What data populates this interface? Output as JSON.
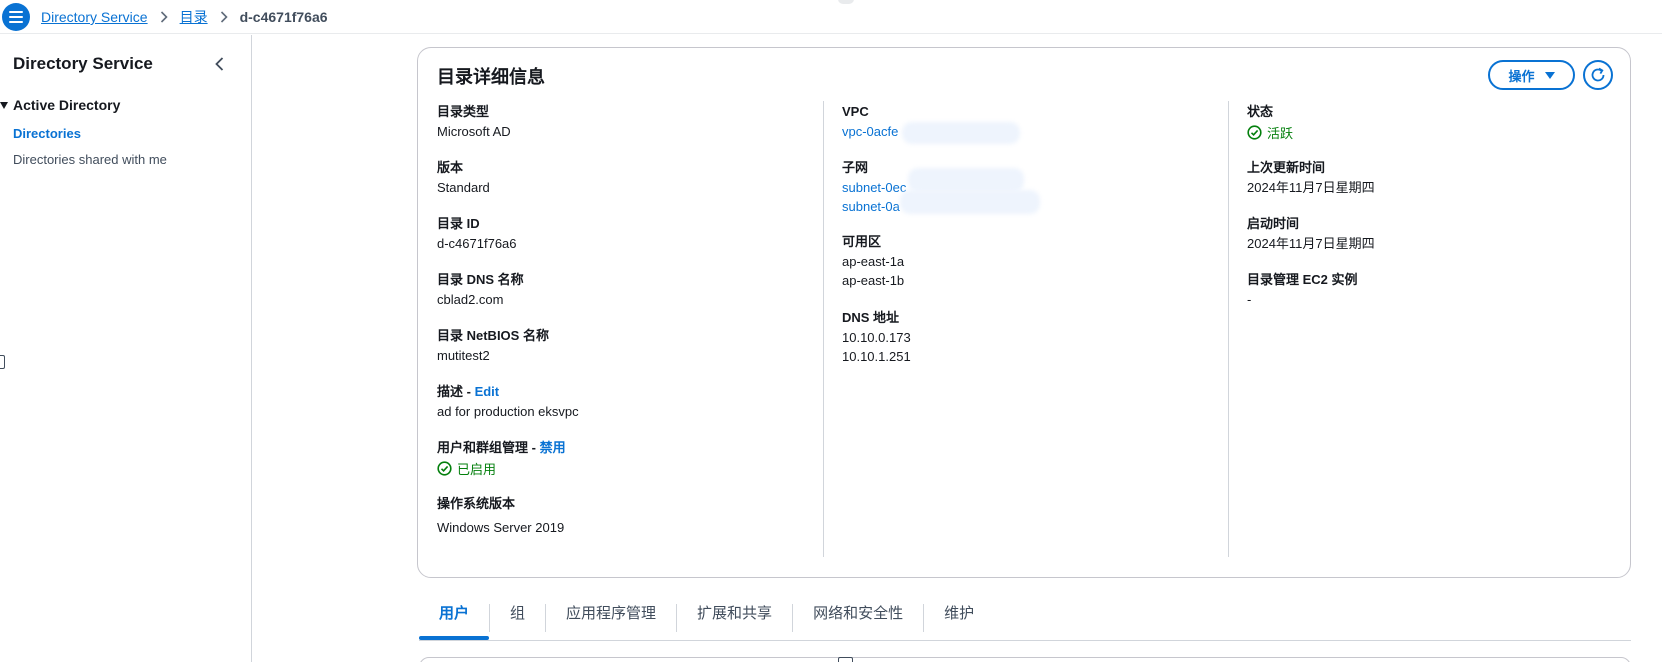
{
  "breadcrumb": {
    "items": [
      "Directory Service",
      "目录"
    ],
    "current": "d-c4671f76a6"
  },
  "sidebar": {
    "title": "Directory Service",
    "section": "Active Directory",
    "items": [
      {
        "label": "Directories",
        "active": true
      },
      {
        "label": "Directories shared with me",
        "active": false
      }
    ]
  },
  "card": {
    "title": "目录详细信息",
    "actions_label": "操作",
    "col1": {
      "type_label": "目录类型",
      "type_value": "Microsoft AD",
      "edition_label": "版本",
      "edition_value": "Standard",
      "id_label": "目录 ID",
      "id_value": "d-c4671f76a6",
      "dns_name_label": "目录 DNS 名称",
      "dns_name_value": "cblad2.com",
      "netbios_label": "目录 NetBIOS 名称",
      "netbios_value": "mutitest2",
      "desc_label": "描述 - ",
      "desc_edit": "Edit",
      "desc_value": "ad for production eksvpc",
      "ugm_label": "用户和群组管理 - ",
      "ugm_action": "禁用",
      "ugm_status": "已启用",
      "os_label": "操作系统版本",
      "os_value": "Windows Server 2019"
    },
    "col2": {
      "vpc_label": "VPC",
      "vpc_value": "vpc-0acfe",
      "subnet_label": "子网",
      "subnets": [
        "subnet-0ec",
        "subnet-0a"
      ],
      "az_label": "可用区",
      "azs": [
        "ap-east-1a",
        "ap-east-1b"
      ],
      "dns_label": "DNS 地址",
      "dns": [
        "10.10.0.173",
        "10.10.1.251"
      ]
    },
    "col3": {
      "status_label": "状态",
      "status_value": "活跃",
      "updated_label": "上次更新时间",
      "updated_value": "2024年11月7日星期四",
      "launched_label": "启动时间",
      "launched_value": "2024年11月7日星期四",
      "ec2_label": "目录管理 EC2 实例",
      "ec2_value": "-"
    }
  },
  "tabs": [
    "用户",
    "组",
    "应用程序管理",
    "扩展和共享",
    "网络和安全性",
    "维护"
  ],
  "colors": {
    "accent": "#0972d3",
    "success": "#037f0c",
    "text": "#16191f",
    "border": "#c6c6cd"
  }
}
